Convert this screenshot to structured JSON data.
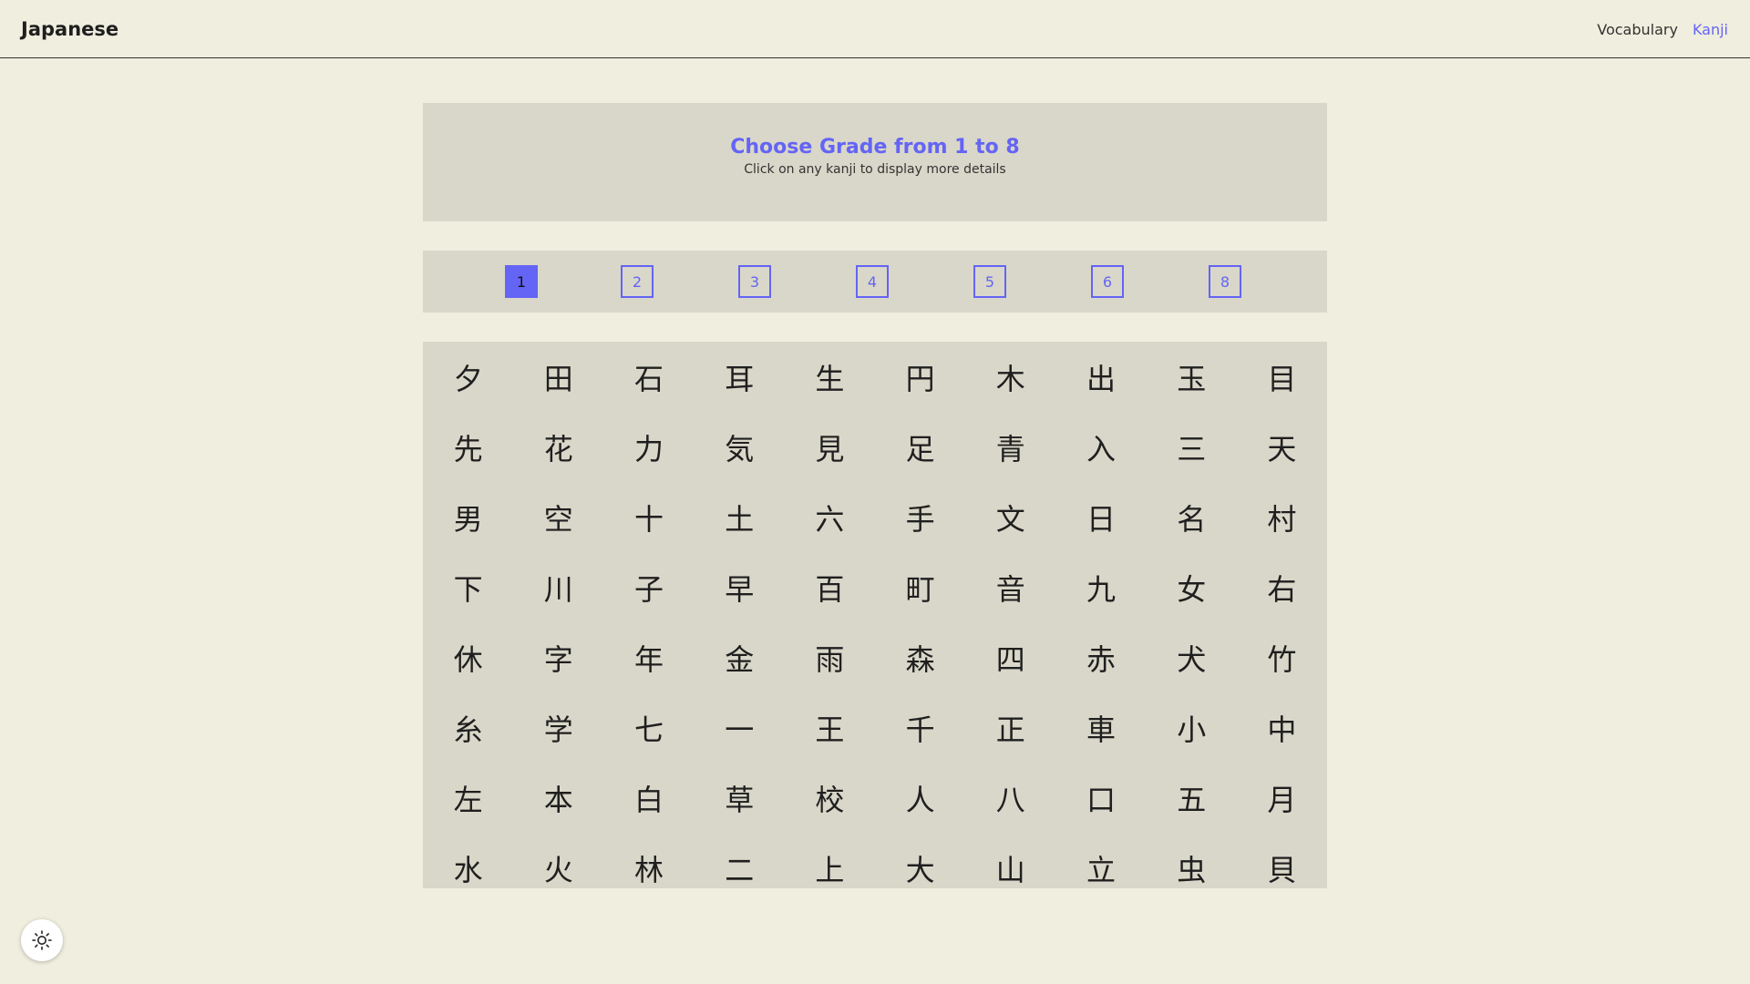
{
  "header": {
    "brand": "Japanese",
    "nav": [
      {
        "label": "Vocabulary",
        "active": false
      },
      {
        "label": "Kanji",
        "active": true
      }
    ]
  },
  "intro": {
    "title": "Choose Grade from 1 to 8",
    "subtitle": "Click on any kanji to display more details"
  },
  "grades": {
    "items": [
      "1",
      "2",
      "3",
      "4",
      "5",
      "6",
      "8"
    ],
    "selected": "1"
  },
  "kanji": [
    "夕",
    "田",
    "石",
    "耳",
    "生",
    "円",
    "木",
    "出",
    "玉",
    "目",
    "先",
    "花",
    "力",
    "気",
    "見",
    "足",
    "青",
    "入",
    "三",
    "天",
    "男",
    "空",
    "十",
    "土",
    "六",
    "手",
    "文",
    "日",
    "名",
    "村",
    "下",
    "川",
    "子",
    "早",
    "百",
    "町",
    "音",
    "九",
    "女",
    "右",
    "休",
    "字",
    "年",
    "金",
    "雨",
    "森",
    "四",
    "赤",
    "犬",
    "竹",
    "糸",
    "学",
    "七",
    "一",
    "王",
    "千",
    "正",
    "車",
    "小",
    "中",
    "左",
    "本",
    "白",
    "草",
    "校",
    "人",
    "八",
    "口",
    "五",
    "月",
    "水",
    "火",
    "林",
    "二",
    "上",
    "大",
    "山",
    "立",
    "虫",
    "貝"
  ],
  "theme_toggle": {
    "icon": "sun-icon"
  },
  "colors": {
    "accent": "#6464f5",
    "background": "#f0eede",
    "panel": "#d9d7c9"
  }
}
